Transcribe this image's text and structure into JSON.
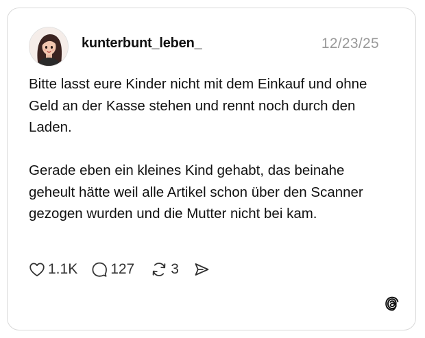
{
  "post": {
    "username": "kunterbunt_leben_",
    "timestamp": "12/23/25",
    "paragraphs": [
      "Bitte lasst eure Kinder nicht mit dem Einkauf und ohne Geld an der Kasse stehen und rennt noch durch den Laden.",
      "Gerade eben ein kleines Kind gehabt, das beinahe geheult hätte weil alle Artikel schon über den Scanner gezogen wurden und die Mutter nicht bei kam."
    ]
  },
  "actions": {
    "likes": "1.1K",
    "replies": "127",
    "reposts": "3"
  },
  "icons": {
    "like": "heart-icon",
    "reply": "comment-bubble-icon",
    "repost": "repost-icon",
    "share": "send-icon",
    "brand": "threads-logo-icon"
  },
  "colors": {
    "text": "#111111",
    "muted": "#999999",
    "border": "#d9d9d9"
  }
}
